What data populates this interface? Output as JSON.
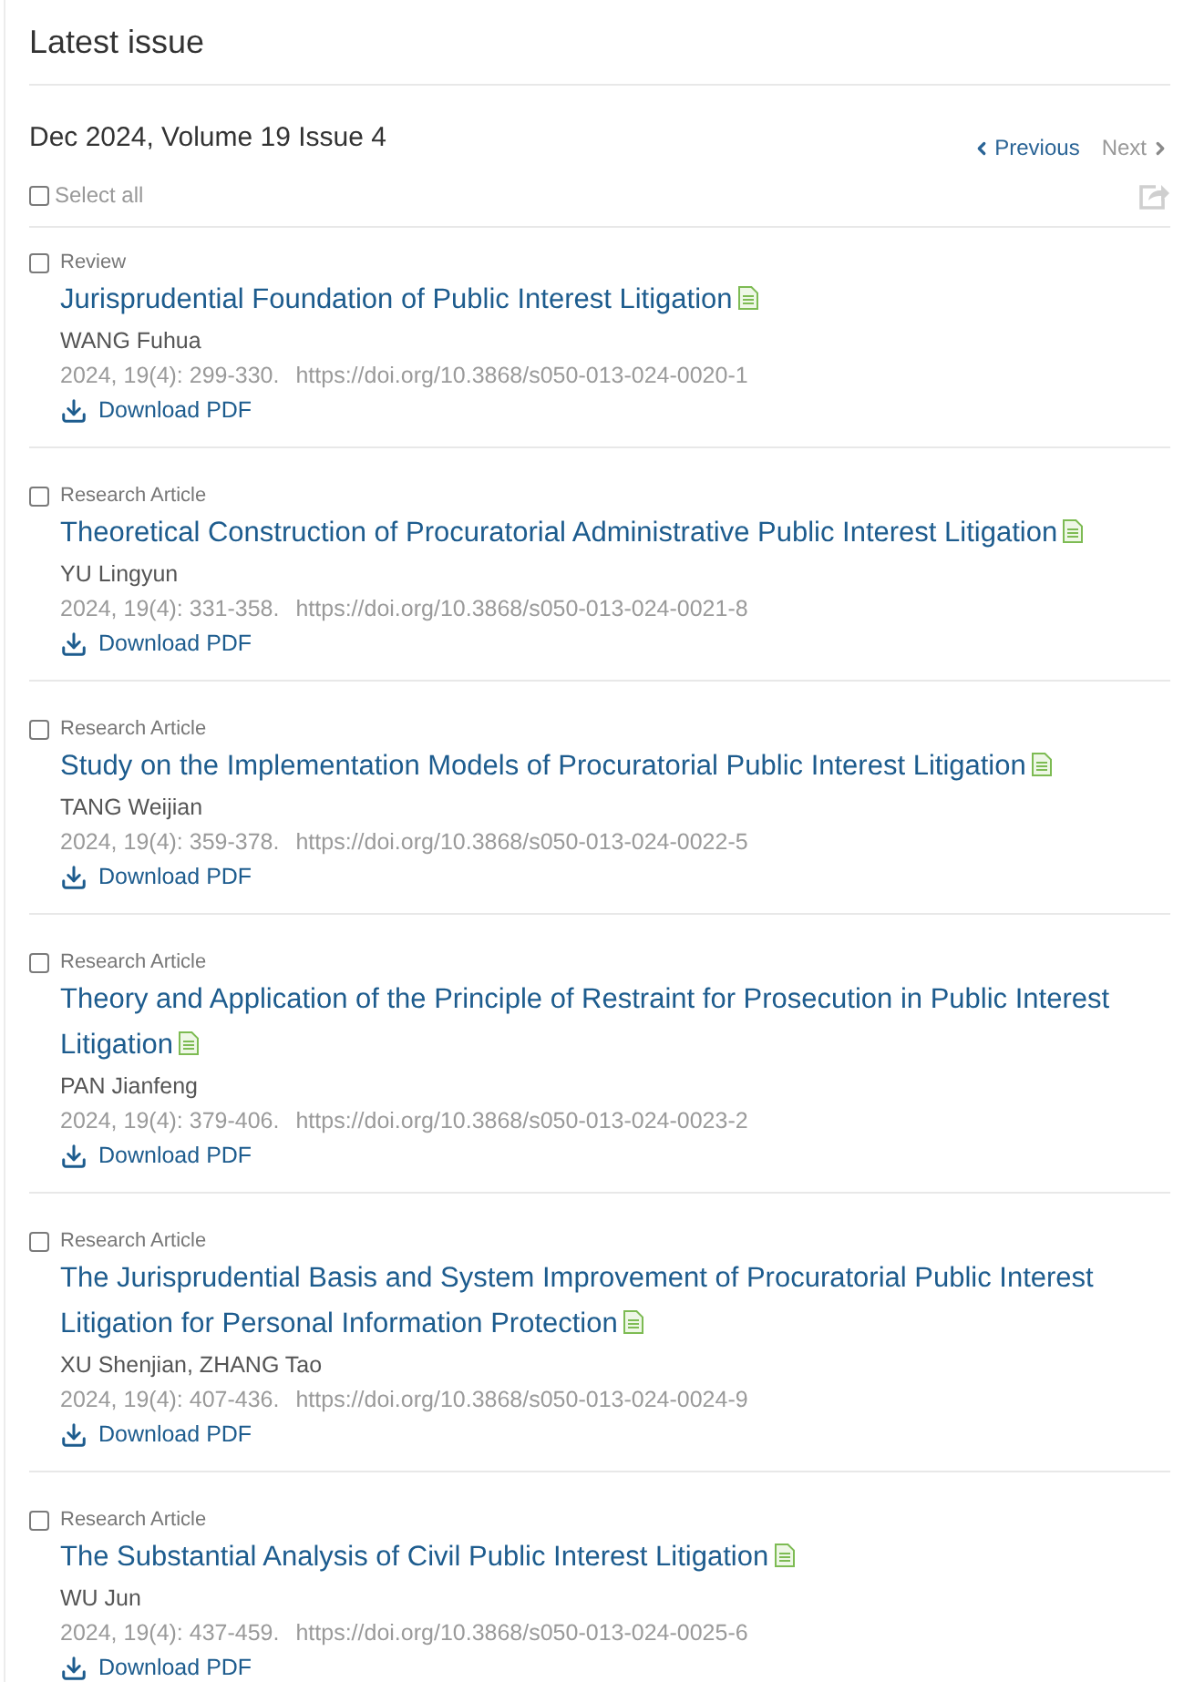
{
  "page": {
    "title": "Latest issue"
  },
  "issue": {
    "title": "Dec 2024, Volume 19 Issue 4",
    "nav": [
      {
        "kind": "previous",
        "label": "Previous",
        "disabled": false
      },
      {
        "kind": "next",
        "label": "Next",
        "disabled": true
      }
    ],
    "select_all": {
      "label": "Select all",
      "checked": false
    }
  },
  "articles": [
    {
      "type": "Review",
      "title": "Jurisprudential Foundation of Public Interest Litigation",
      "authors": "WANG Fuhua",
      "citation": "2024, 19(4): 299-330.",
      "doi": "https://doi.org/10.3868/s050-013-024-0020-1",
      "download": "Download PDF",
      "checked": false
    },
    {
      "type": "Research Article",
      "title": "Theoretical Construction of Procuratorial Administrative Public Interest Litigation",
      "authors": "YU Lingyun",
      "citation": "2024, 19(4): 331-358.",
      "doi": "https://doi.org/10.3868/s050-013-024-0021-8",
      "download": "Download PDF",
      "checked": false
    },
    {
      "type": "Research Article",
      "title": "Study on the Implementation Models of Procuratorial Public Interest Litigation",
      "authors": "TANG Weijian",
      "citation": "2024, 19(4): 359-378.",
      "doi": "https://doi.org/10.3868/s050-013-024-0022-5",
      "download": "Download PDF",
      "checked": false
    },
    {
      "type": "Research Article",
      "title": "Theory and Application of the Principle of Restraint for Prosecution in Public Interest Litigation",
      "authors": "PAN Jianfeng",
      "citation": "2024, 19(4): 379-406.",
      "doi": "https://doi.org/10.3868/s050-013-024-0023-2",
      "download": "Download PDF",
      "checked": false
    },
    {
      "type": "Research Article",
      "title": "The Jurisprudential Basis and System Improvement of Procuratorial Public Interest Litigation for Personal Information Protection",
      "authors": "XU Shenjian, ZHANG Tao",
      "citation": "2024, 19(4): 407-436.",
      "doi": "https://doi.org/10.3868/s050-013-024-0024-9",
      "download": "Download PDF",
      "checked": false
    },
    {
      "type": "Research Article",
      "title": "The Substantial Analysis of Civil Public Interest Litigation",
      "authors": "WU Jun",
      "citation": "2024, 19(4): 437-459.",
      "doi": "https://doi.org/10.3868/s050-013-024-0025-6",
      "download": "Download PDF",
      "checked": false
    }
  ]
}
